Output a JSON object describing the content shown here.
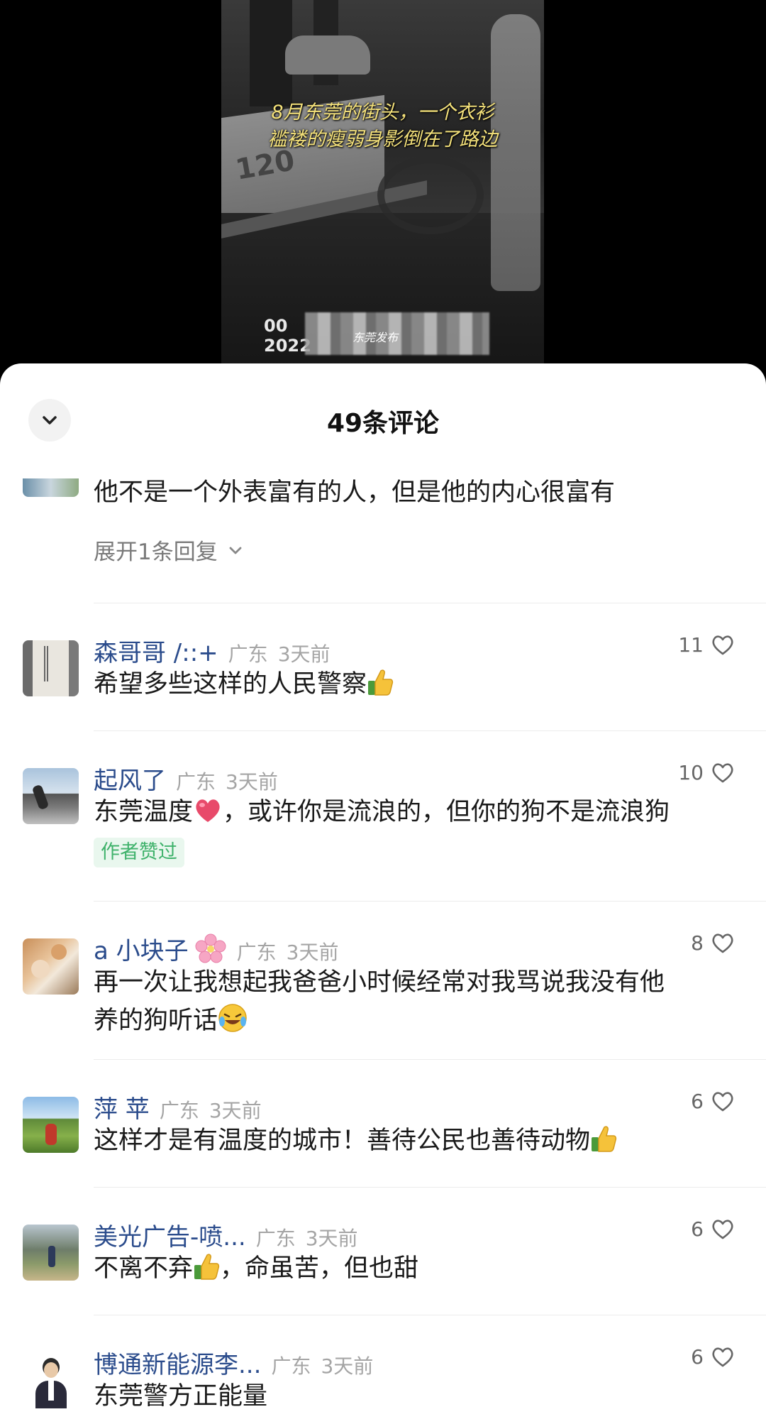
{
  "video": {
    "caption_line1": "8月东莞的街头，一个衣衫",
    "caption_line2": "褴褛的瘦弱身影倒在了路边",
    "timestamp_top": "00",
    "timestamp_bottom": "2022",
    "watermark": "东莞发布",
    "ambulance_text": "120"
  },
  "sheet": {
    "title": "49条评论",
    "collapse_icon": "chevron-down-icon"
  },
  "first_comment": {
    "text": "他不是一个外表富有的人，但是他的内心很富有",
    "expand_label": "展开1条回复"
  },
  "comments": [
    {
      "author": "森哥哥 /::+",
      "location": "广东",
      "time": "3天前",
      "likes": "11",
      "text": "希望多些这样的人民警察",
      "emoji": "thumbs-up"
    },
    {
      "author": "起风了",
      "location": "广东",
      "time": "3天前",
      "likes": "10",
      "text_before": "东莞温度",
      "text_after": "，或许你是流浪的，但你的狗不是流浪狗",
      "emoji": "heart",
      "badge": "作者赞过"
    },
    {
      "author": "a 小块子",
      "location": "广东",
      "time": "3天前",
      "likes": "8",
      "text_line1": "再一次让我想起我爸爸小时候经常对我骂说我没有他",
      "text_line2": "养的狗听话",
      "emoji": "laughing-crying",
      "author_emoji": "cherry-blossom"
    },
    {
      "author": "萍 苹",
      "location": "广东",
      "time": "3天前",
      "likes": "6",
      "text": "这样才是有温度的城市！善待公民也善待动物",
      "emoji": "thumbs-up"
    },
    {
      "author": "美光广告-喷...",
      "location": "广东",
      "time": "3天前",
      "likes": "6",
      "text_before": "不离不弃",
      "text_after": "，命虽苦，但也甜",
      "emoji": "thumbs-up"
    },
    {
      "author": "博通新能源李...",
      "location": "广东",
      "time": "3天前",
      "likes": "6",
      "text": "东莞警方正能量"
    }
  ],
  "colors": {
    "author_name": "#2b4c8c",
    "meta": "#a5a5a5",
    "badge_bg": "#e9f7ee",
    "badge_text": "#3fb26b"
  }
}
